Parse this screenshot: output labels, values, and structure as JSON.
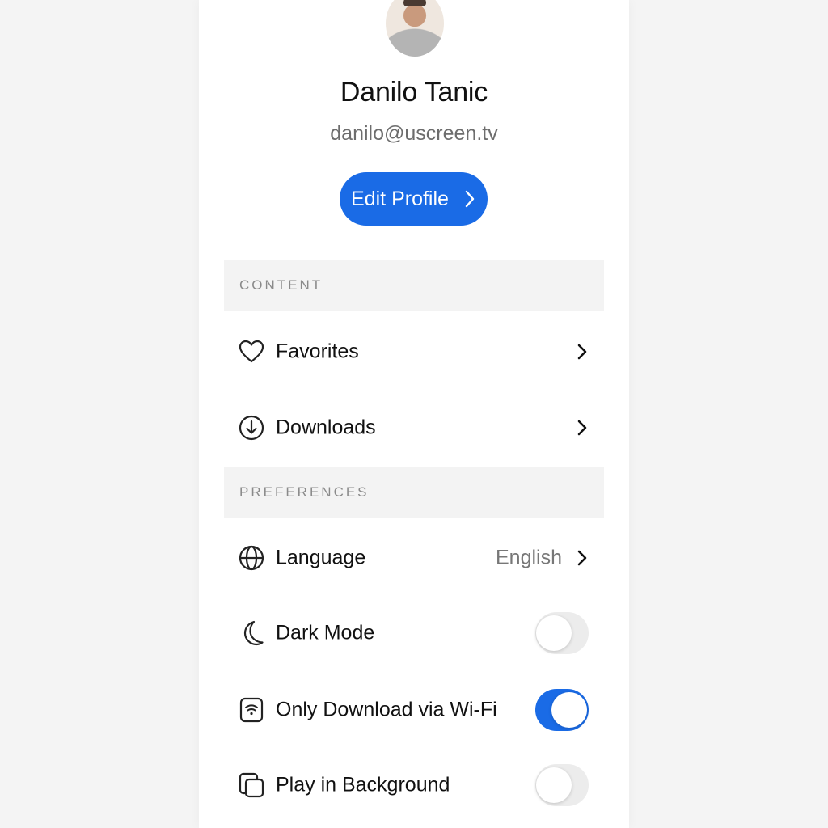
{
  "profile": {
    "name": "Danilo Tanic",
    "email": "danilo@uscreen.tv",
    "edit_label": "Edit Profile"
  },
  "sections": {
    "content": "CONTENT",
    "preferences": "PREFERENCES"
  },
  "content_items": [
    {
      "label": "Favorites",
      "icon": "heart-icon"
    },
    {
      "label": "Downloads",
      "icon": "download-icon"
    }
  ],
  "preference_items": [
    {
      "label": "Language",
      "icon": "globe-icon",
      "value": "English"
    },
    {
      "label": "Dark Mode",
      "icon": "moon-icon",
      "toggle": false
    },
    {
      "label": "Only Download via Wi-Fi",
      "icon": "wifi-icon",
      "toggle": true
    },
    {
      "label": "Play in Background",
      "icon": "picture-in-picture-icon",
      "toggle": false
    }
  ],
  "colors": {
    "accent": "#1a6be6",
    "section_bg": "#f3f3f3",
    "page_bg": "#f4f4f4"
  }
}
